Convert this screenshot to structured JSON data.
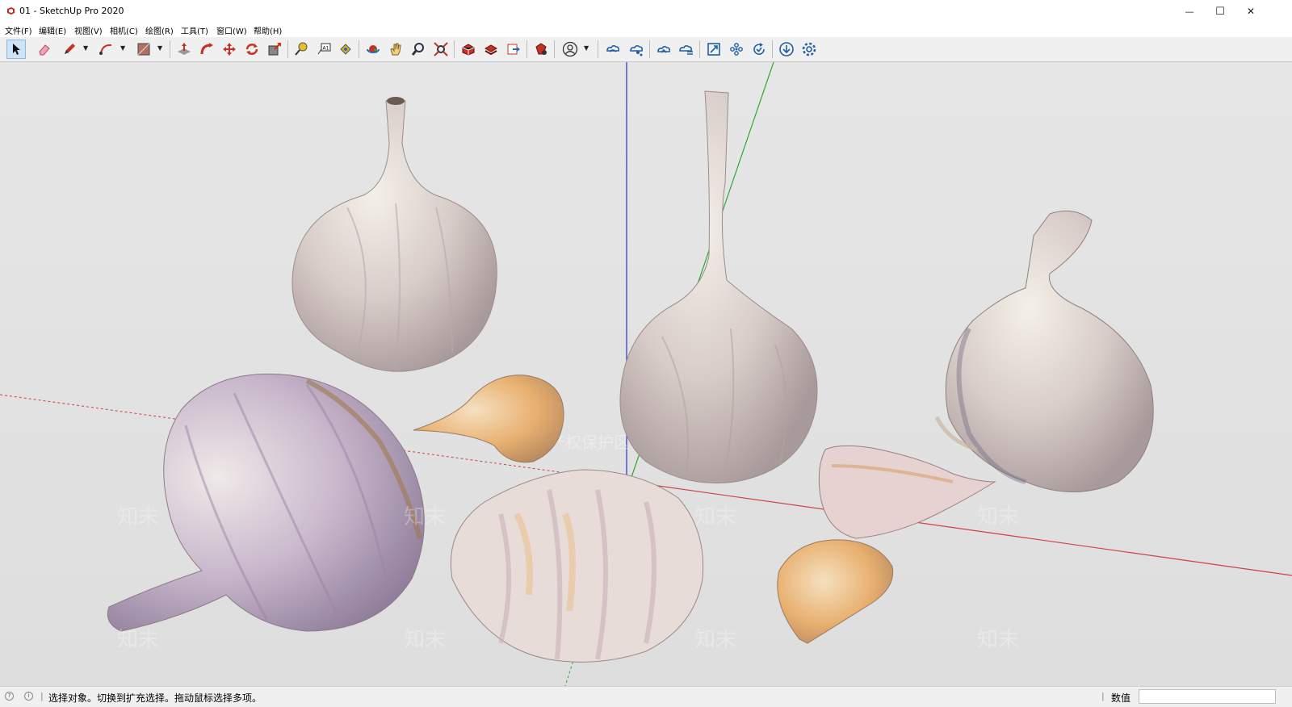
{
  "window": {
    "title": "01 - SketchUp Pro 2020",
    "minimize_glyph": "—",
    "maximize_glyph": "☐",
    "close_glyph": "✕"
  },
  "menu": {
    "items": [
      {
        "label": "文件(F)"
      },
      {
        "label": "编辑(E)"
      },
      {
        "label": "视图(V)"
      },
      {
        "label": "相机(C)"
      },
      {
        "label": "绘图(R)"
      },
      {
        "label": "工具(T)"
      },
      {
        "label": "窗口(W)"
      },
      {
        "label": "帮助(H)"
      }
    ]
  },
  "toolbar": {
    "tools": [
      "select-tool-icon",
      "eraser-tool-icon",
      "pencil-tool-icon",
      "arc-tool-icon",
      "rectangle-tool-icon",
      "push-pull-tool-icon",
      "follow-me-tool-icon",
      "move-tool-icon",
      "rotate-tool-icon",
      "scale-tool-icon",
      "tape-measure-tool-icon",
      "text-tool-icon",
      "paint-bucket-tool-icon",
      "orbit-tool-icon",
      "pan-tool-icon",
      "zoom-tool-icon",
      "zoom-extents-tool-icon",
      "3d-warehouse-icon",
      "extension-warehouse-icon",
      "layout-send-icon",
      "extension-manager-icon",
      "user-account-icon",
      "trimble-connect-icon",
      "trimble-share-icon",
      "cloud-sync-icon",
      "cloud-list-icon",
      "cloud-frame-icon",
      "cloud-group-icon",
      "cloud-refresh-icon",
      "download-icon",
      "settings-gear-icon"
    ],
    "active_tool": "select-tool-icon"
  },
  "viewport": {
    "background": "#e6e6e6",
    "axis_colors": {
      "red": "#d04040",
      "green": "#2fa82f",
      "blue": "#3030c8"
    },
    "watermark": {
      "logo_text": "知末",
      "banner_text": "知识产权保护区 画面会受到部分影响"
    }
  },
  "status": {
    "message": "选择对象。切换到扩充选择。拖动鼠标选择多项。",
    "measurements_label": "数值",
    "measurements_value": ""
  }
}
